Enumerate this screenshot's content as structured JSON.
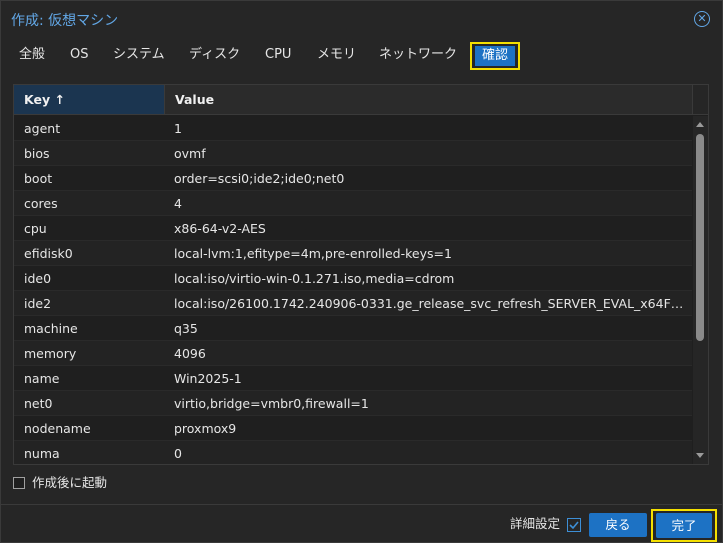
{
  "dialog": {
    "title": "作成: 仮想マシン"
  },
  "tabs": [
    {
      "label": "全般"
    },
    {
      "label": "OS"
    },
    {
      "label": "システム"
    },
    {
      "label": "ディスク"
    },
    {
      "label": "CPU"
    },
    {
      "label": "メモリ"
    },
    {
      "label": "ネットワーク"
    },
    {
      "label": "確認",
      "active": true
    }
  ],
  "grid": {
    "columns": {
      "key": "Key ↑",
      "value": "Value"
    },
    "rows": [
      {
        "key": "agent",
        "value": "1"
      },
      {
        "key": "bios",
        "value": "ovmf"
      },
      {
        "key": "boot",
        "value": "order=scsi0;ide2;ide0;net0"
      },
      {
        "key": "cores",
        "value": "4"
      },
      {
        "key": "cpu",
        "value": "x86-64-v2-AES"
      },
      {
        "key": "efidisk0",
        "value": "local-lvm:1,efitype=4m,pre-enrolled-keys=1"
      },
      {
        "key": "ide0",
        "value": "local:iso/virtio-win-0.1.271.iso,media=cdrom"
      },
      {
        "key": "ide2",
        "value": "local:iso/26100.1742.240906-0331.ge_release_svc_refresh_SERVER_EVAL_x64FR..."
      },
      {
        "key": "machine",
        "value": "q35"
      },
      {
        "key": "memory",
        "value": "4096"
      },
      {
        "key": "name",
        "value": "Win2025-1"
      },
      {
        "key": "net0",
        "value": "virtio,bridge=vmbr0,firewall=1"
      },
      {
        "key": "nodename",
        "value": "proxmox9"
      },
      {
        "key": "numa",
        "value": "0"
      }
    ]
  },
  "options": {
    "autostart_label": "作成後に起動",
    "autostart_checked": false
  },
  "footer": {
    "advanced_label": "詳細設定",
    "advanced_checked": true,
    "back_label": "戻る",
    "finish_label": "完了"
  },
  "colors": {
    "accent": "#1d72c4",
    "highlight": "#f5e000",
    "title": "#62a7e6"
  }
}
